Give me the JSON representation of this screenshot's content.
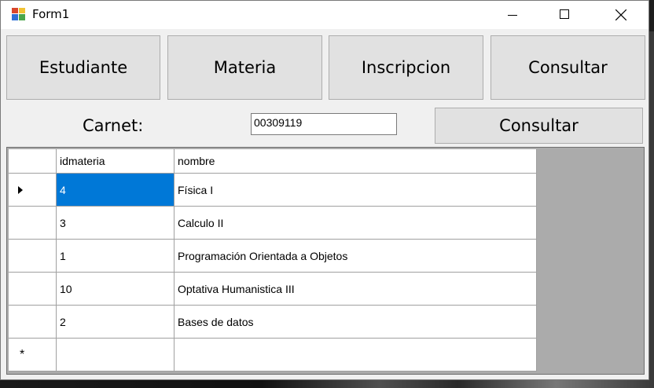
{
  "window": {
    "title": "Form1"
  },
  "nav_buttons": [
    "Estudiante",
    "Materia",
    "Inscripcion",
    "Consultar"
  ],
  "carnet": {
    "label": "Carnet:",
    "value": "00309119"
  },
  "consult_button": "Consultar",
  "grid": {
    "columns": [
      "idmateria",
      "nombre"
    ],
    "rows": [
      {
        "idmateria": "4",
        "nombre": "Física I"
      },
      {
        "idmateria": "3",
        "nombre": "Calculo II"
      },
      {
        "idmateria": "1",
        "nombre": "Programación Orientada a Objetos"
      },
      {
        "idmateria": "10",
        "nombre": "Optativa Humanistica III"
      },
      {
        "idmateria": "2",
        "nombre": "Bases de datos"
      }
    ],
    "selected_row": 0,
    "new_row_marker": "*"
  },
  "colors": {
    "selection": "#0078d7",
    "grid_background": "#ababab"
  }
}
